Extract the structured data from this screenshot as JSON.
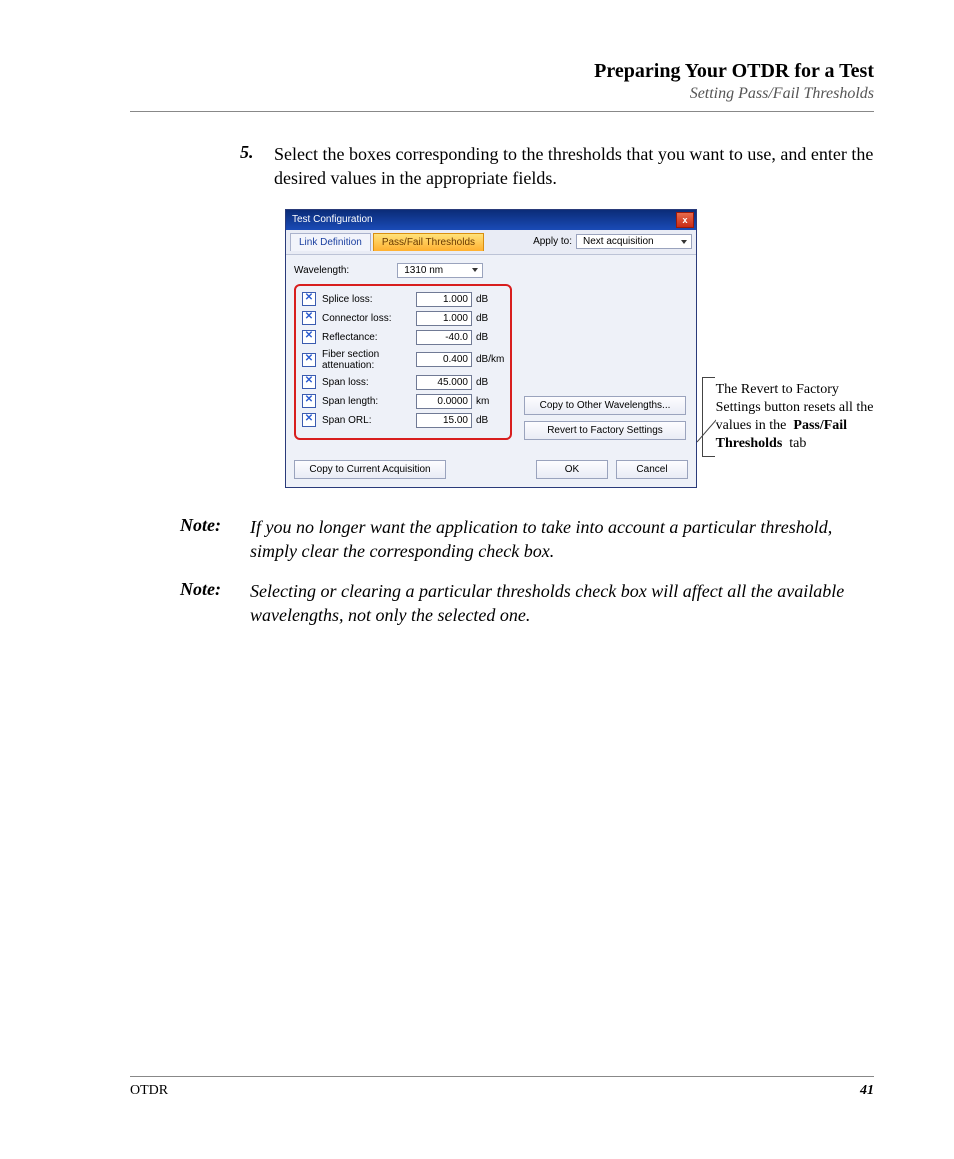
{
  "header": {
    "title": "Preparing Your OTDR for a Test",
    "subtitle": "Setting Pass/Fail Thresholds"
  },
  "step": {
    "number": "5.",
    "text": "Select the boxes corresponding to the thresholds that you want to use, and enter the desired values in the appropriate fields."
  },
  "dialog": {
    "title": "Test Configuration",
    "close_glyph": "x",
    "tabs": {
      "link_definition": "Link Definition",
      "pass_fail": "Pass/Fail Thresholds"
    },
    "apply_to_label": "Apply to:",
    "apply_to_value": "Next acquisition",
    "wavelength_label": "Wavelength:",
    "wavelength_value": "1310 nm",
    "thresholds": [
      {
        "label": "Splice loss:",
        "value": "1.000",
        "unit": "dB"
      },
      {
        "label": "Connector loss:",
        "value": "1.000",
        "unit": "dB"
      },
      {
        "label": "Reflectance:",
        "value": "-40.0",
        "unit": "dB"
      },
      {
        "label": "Fiber section attenuation:",
        "value": "0.400",
        "unit": "dB/km"
      },
      {
        "label": "Span loss:",
        "value": "45.000",
        "unit": "dB"
      },
      {
        "label": "Span length:",
        "value": "0.0000",
        "unit": "km"
      },
      {
        "label": "Span ORL:",
        "value": "15.00",
        "unit": "dB"
      }
    ],
    "btn_copy_wavelengths": "Copy to Other Wavelengths...",
    "btn_revert": "Revert to Factory Settings",
    "btn_copy_current": "Copy to Current Acquisition",
    "btn_ok": "OK",
    "btn_cancel": "Cancel"
  },
  "callout": {
    "line1": "The Revert to Factory Settings button resets all the values in the",
    "bold": "Pass/Fail Thresholds",
    "line3": "tab"
  },
  "notes": {
    "label": "Note:",
    "note1": "If you no longer want the application to take into account a particular threshold, simply clear the corresponding check box.",
    "note2": "Selecting or clearing a particular thresholds check box will affect all the available wavelengths, not only the selected one."
  },
  "footer": {
    "left": "OTDR",
    "page": "41"
  }
}
